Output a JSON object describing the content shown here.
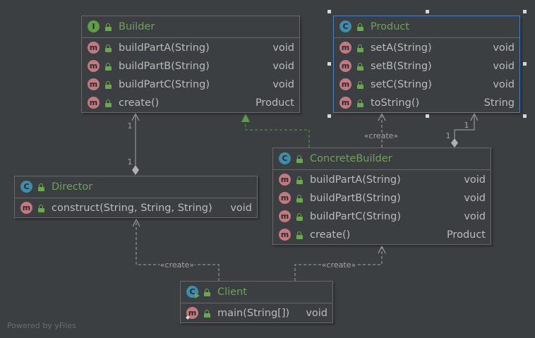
{
  "icons": {
    "interface_glyph": "I",
    "class_glyph": "C",
    "method_glyph": "m"
  },
  "classes": [
    {
      "name": "Builder",
      "icon": "interface-icon",
      "visibility_icon": "lock-icon",
      "methods": [
        {
          "name": "buildPartA(String)",
          "type": "void"
        },
        {
          "name": "buildPartB(String)",
          "type": "void"
        },
        {
          "name": "buildPartC(String)",
          "type": "void"
        },
        {
          "name": "create()",
          "type": "Product"
        }
      ]
    },
    {
      "name": "Product",
      "icon": "class-icon",
      "visibility_icon": "lock-icon",
      "selected": true,
      "methods": [
        {
          "name": "setA(String)",
          "type": "void"
        },
        {
          "name": "setB(String)",
          "type": "void"
        },
        {
          "name": "setC(String)",
          "type": "void"
        },
        {
          "name": "toString()",
          "type": "String"
        }
      ]
    },
    {
      "name": "Director",
      "icon": "class-icon",
      "visibility_icon": "lock-icon",
      "methods": [
        {
          "name": "construct(String, String, String)",
          "type": "void"
        }
      ]
    },
    {
      "name": "ConcreteBuilder",
      "icon": "class-icon",
      "visibility_icon": "lock-icon",
      "methods": [
        {
          "name": "buildPartA(String)",
          "type": "void"
        },
        {
          "name": "buildPartB(String)",
          "type": "void"
        },
        {
          "name": "buildPartC(String)",
          "type": "void"
        },
        {
          "name": "create()",
          "type": "Product"
        }
      ]
    },
    {
      "name": "Client",
      "icon": "runnable-class-icon",
      "visibility_icon": "lock-icon",
      "methods": [
        {
          "name": "main(String[])",
          "type": "void",
          "icon": "static-method-icon"
        }
      ]
    }
  ],
  "relations": {
    "director_builder": {
      "target_multiplicity": "1",
      "source_multiplicity": "1"
    },
    "concretebuilder_product_create": {
      "label": "«create»"
    },
    "concretebuilder_product": {
      "target_multiplicity": "1",
      "source_multiplicity": "1"
    },
    "client_director_create": {
      "label": "«create»"
    },
    "client_concretebuilder_create": {
      "label": "«create»"
    }
  },
  "footer": "Powered by yFiles",
  "colors": {
    "background": "#3c3f41",
    "box_border": "#66686a",
    "selected_border": "#4d82c2",
    "class_name": "#72a05a",
    "member_text": "#bbbbbb",
    "edge": "#a6a6a6",
    "realization_edge": "#5b9a46",
    "icon_class": "#3f8cab",
    "icon_interface": "#5f9e47",
    "icon_method": "#c47882",
    "lock": "#6aa84f",
    "label_text": "#a3a3a3",
    "footer_text": "#6b6d6f",
    "diamond": "#b0b0b0",
    "handle": "#d8d8d8"
  }
}
